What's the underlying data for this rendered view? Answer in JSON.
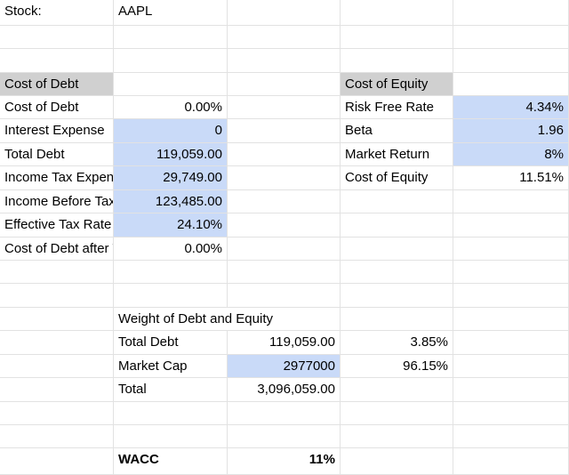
{
  "stock": {
    "label": "Stock:",
    "ticker": "AAPL"
  },
  "cost_of_debt": {
    "header": "Cost of Debt",
    "rows": [
      {
        "label": "Cost of Debt",
        "value": "0.00%",
        "highlighted": false
      },
      {
        "label": "Interest Expense",
        "value": "0",
        "highlighted": true
      },
      {
        "label": "Total Debt",
        "value": "119,059.00",
        "highlighted": true
      },
      {
        "label": "Income Tax Expense",
        "value": "29,749.00",
        "highlighted": true
      },
      {
        "label": "Income Before Tax",
        "value": "123,485.00",
        "highlighted": true
      },
      {
        "label": "Effective Tax Rate",
        "value": "24.10%",
        "highlighted": true
      },
      {
        "label": "Cost of Debt after Tax",
        "value": "0.00%",
        "highlighted": false
      }
    ]
  },
  "cost_of_equity": {
    "header": "Cost of Equity",
    "rows": [
      {
        "label": "Risk Free Rate",
        "value": "4.34%",
        "highlighted": true
      },
      {
        "label": "Beta",
        "value": "1.96",
        "highlighted": true
      },
      {
        "label": "Market Return",
        "value": "8%",
        "highlighted": true
      },
      {
        "label": "Cost of Equity",
        "value": "11.51%",
        "highlighted": false
      }
    ]
  },
  "weights": {
    "title": "Weight of Debt and Equity",
    "rows": [
      {
        "label": "Total Debt",
        "value": "119,059.00",
        "percent": "3.85%",
        "highlighted": false
      },
      {
        "label": "Market Cap",
        "value": "2977000",
        "percent": "96.15%",
        "highlighted": true
      },
      {
        "label": "Total",
        "value": "3,096,059.00",
        "percent": "",
        "highlighted": false
      }
    ]
  },
  "wacc": {
    "label": "WACC",
    "value": "11%"
  },
  "colors": {
    "highlight": "#c9daf8",
    "header": "#d0d0d0",
    "gridline": "#e2e2e2"
  }
}
